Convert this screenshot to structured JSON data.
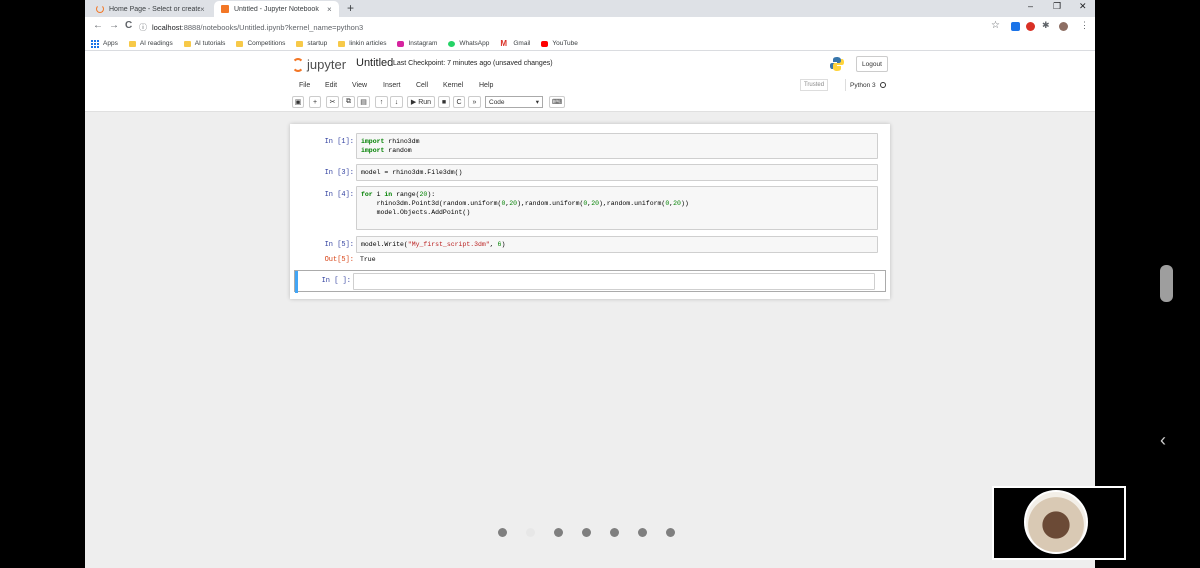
{
  "browser": {
    "tabs": [
      {
        "title": "Home Page - Select or create a",
        "close": "×"
      },
      {
        "title": "Untitled - Jupyter Notebook",
        "close": "×"
      }
    ],
    "new_tab": "+",
    "window_controls": {
      "minimize": "–",
      "restore": "❐",
      "close": "✕"
    },
    "nav": {
      "back": "←",
      "forward": "→",
      "reload": "C"
    },
    "url_host": "localhost",
    "url_path": ":8888/notebooks/Untitled.ipynb?kernel_name=python3",
    "bookmarks": [
      {
        "label": "Apps",
        "icon": "apps-grid-icon"
      },
      {
        "label": "AI readings",
        "icon": "folder-icon"
      },
      {
        "label": "AI tutorials",
        "icon": "folder-icon"
      },
      {
        "label": "Competitions",
        "icon": "folder-icon"
      },
      {
        "label": "startup",
        "icon": "folder-icon"
      },
      {
        "label": "linkin articles",
        "icon": "folder-icon"
      },
      {
        "label": "Instagram",
        "icon": "instagram-icon"
      },
      {
        "label": "WhatsApp",
        "icon": "whatsapp-icon"
      },
      {
        "label": "Gmail",
        "icon": "gmail-icon"
      },
      {
        "label": "YouTube",
        "icon": "youtube-icon"
      }
    ]
  },
  "jupyter": {
    "logo_text": "jupyter",
    "notebook_title": "Untitled",
    "checkpoint": "Last Checkpoint: 7 minutes ago  (unsaved changes)",
    "logout": "Logout",
    "menu": [
      "File",
      "Edit",
      "View",
      "Insert",
      "Cell",
      "Kernel",
      "Help"
    ],
    "trusted": "Trusted",
    "kernel": "Python 3",
    "toolbar": {
      "run": "▶ Run",
      "cell_type": "Code"
    },
    "accent": "#f37726"
  },
  "cells": [
    {
      "prompt": "In [1]:",
      "lines": [
        "import rhino3dm",
        "import random"
      ]
    },
    {
      "prompt": "In [3]:",
      "lines": [
        "model = rhino3dm.File3dm()"
      ]
    },
    {
      "prompt": "In [4]:",
      "lines": [
        "for i in range(20):",
        "    rhino3dm.Point3d(random.uniform(0,20),random.uniform(0,20),random.uniform(0,20))",
        "    model.Objects.AddPoint()"
      ]
    },
    {
      "prompt": "In [5]:",
      "lines": [
        "model.Write(\"My_first_script.3dm\", 6)"
      ],
      "out_prompt": "Out[5]:",
      "output": "True"
    },
    {
      "prompt": "In [ ]:",
      "lines": [
        ""
      ]
    }
  ],
  "overlay": {
    "chevron": "‹",
    "slide_count": 7,
    "current_slide": 2
  }
}
